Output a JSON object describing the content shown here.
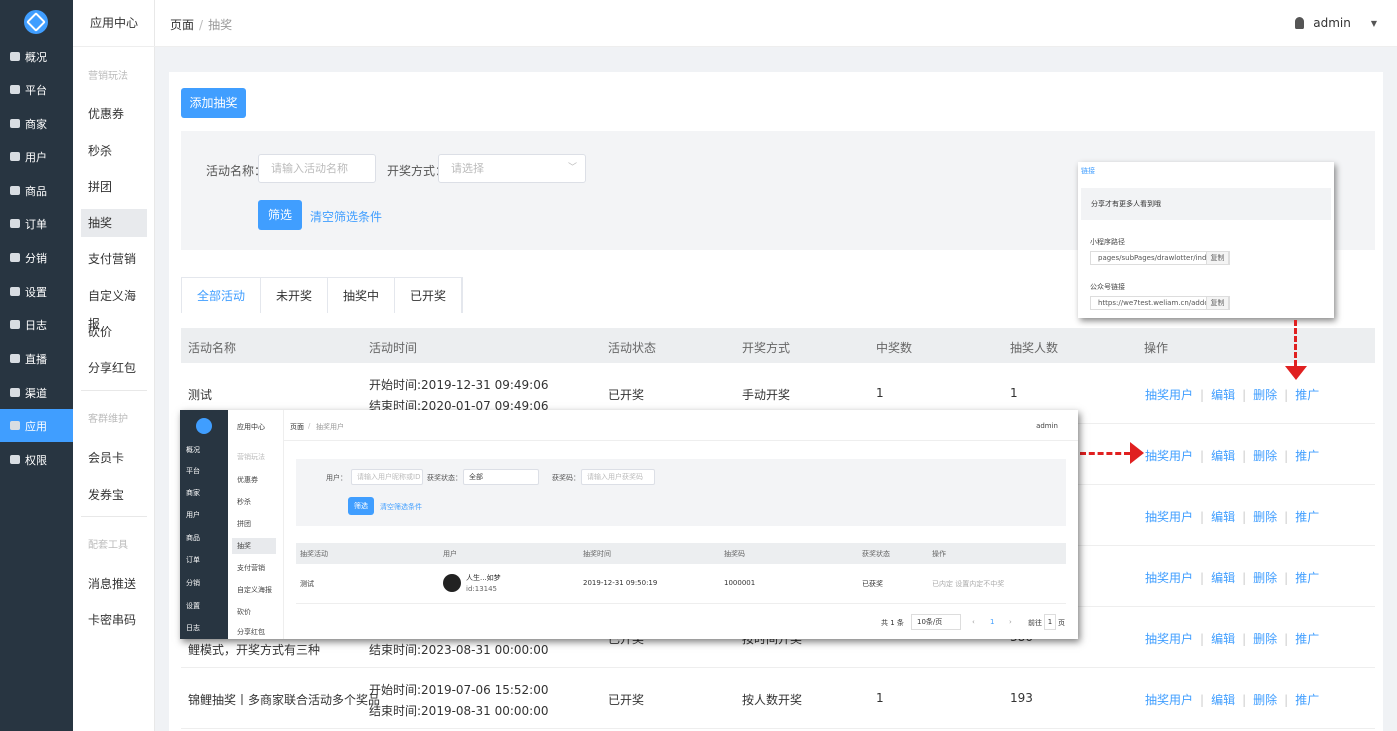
{
  "rail": {
    "items": [
      {
        "label": "概况",
        "icon": "monitor-icon"
      },
      {
        "label": "平台",
        "icon": "platform-icon"
      },
      {
        "label": "商家",
        "icon": "store-icon"
      },
      {
        "label": "用户",
        "icon": "user-icon"
      },
      {
        "label": "商品",
        "icon": "goods-icon"
      },
      {
        "label": "订单",
        "icon": "order-icon"
      },
      {
        "label": "分销",
        "icon": "distribution-icon"
      },
      {
        "label": "设置",
        "icon": "gear-icon"
      },
      {
        "label": "日志",
        "icon": "log-icon"
      },
      {
        "label": "直播",
        "icon": "live-icon"
      },
      {
        "label": "渠道",
        "icon": "channel-icon"
      },
      {
        "label": "应用",
        "icon": "apps-icon"
      },
      {
        "label": "权限",
        "icon": "lock-icon"
      }
    ]
  },
  "side": {
    "title": "应用中心",
    "group1": "营销玩法",
    "g1items": [
      "优惠券",
      "秒杀",
      "拼团",
      "抽奖",
      "支付营销",
      "自定义海报",
      "砍价",
      "分享红包"
    ],
    "group2": "客群维护",
    "g2items": [
      "会员卡",
      "发券宝"
    ],
    "group3": "配套工具",
    "g3items": [
      "消息推送",
      "卡密串码"
    ]
  },
  "topbar": {
    "crumb1": "页面",
    "sep": "/",
    "crumb2": "抽奖",
    "user": "admin",
    "caret": "▼"
  },
  "main": {
    "add_button": "添加抽奖",
    "filter": {
      "name_label": "活动名称：",
      "name_placeholder": "请输入活动名称",
      "mode_label": "开奖方式：",
      "mode_placeholder": "请选择",
      "search": "筛选",
      "clear": "清空筛选条件"
    },
    "tabs": [
      "全部活动",
      "未开奖",
      "抽奖中",
      "已开奖"
    ],
    "columns": [
      "活动名称",
      "活动时间",
      "活动状态",
      "开奖方式",
      "中奖数",
      "抽奖人数",
      "操作"
    ],
    "rows": [
      {
        "name": "测试",
        "start": "开始时间:2019-12-31 09:49:06",
        "end": "结束时间:2020-01-07 09:49:06",
        "status": "已开奖",
        "mode": "手动开奖",
        "winners": "1",
        "players": "1"
      },
      {
        "name": "",
        "start": "",
        "end": "",
        "status": "",
        "mode": "",
        "winners": "",
        "players": ""
      },
      {
        "name": "",
        "start": "",
        "end": "",
        "status": "",
        "mode": "",
        "winners": "",
        "players": ""
      },
      {
        "name": "",
        "start": "",
        "end": "",
        "status": "",
        "mode": "",
        "winners": "",
        "players": ""
      },
      {
        "name": "鲤模式，开奖方式有三种",
        "start": "",
        "end": "结束时间:2023-08-31 00:00:00",
        "status": "已开奖",
        "mode": "按时间开奖",
        "winners": "",
        "players": "386"
      },
      {
        "name": "锦鲤抽奖丨多商家联合活动多个奖品",
        "start": "开始时间:2019-07-06 15:52:00",
        "end": "结束时间:2019-08-31 00:00:00",
        "status": "已开奖",
        "mode": "按人数开奖",
        "winners": "1",
        "players": "193"
      }
    ],
    "ops": {
      "users": "抽奖用户",
      "edit": "编辑",
      "delete": "删除",
      "promote": "推广",
      "sep": "|"
    }
  },
  "popup": {
    "link": "链接",
    "band": "分享才有更多人看到哦",
    "mini_label": "小程序路径",
    "mini_value": "pages/subPages/drawlotter/index",
    "official_label": "公众号链接",
    "official_value": "https://we7test.weliam.cn/addons",
    "copy": "复制"
  },
  "inset": {
    "side_title": "应用中心",
    "group": "营销玩法",
    "side_items": [
      "优惠券",
      "秒杀",
      "拼团",
      "抽奖",
      "支付营销",
      "自定义海报",
      "砍价",
      "分享红包"
    ],
    "rail": [
      "概况",
      "平台",
      "商家",
      "用户",
      "商品",
      "订单",
      "分销",
      "设置",
      "日志"
    ],
    "crumb1": "页面",
    "crumb2": "抽奖用户",
    "user": "admin",
    "f_user": "用户：",
    "f_user_ph": "请输入用户昵称或ID",
    "f_state": "获奖状态：",
    "f_state_val": "全部",
    "f_code": "获奖码：",
    "f_code_ph": "请输入用户获奖码",
    "search": "筛选",
    "clear": "清空筛选条件",
    "columns": [
      "抽奖活动",
      "用户",
      "抽奖时间",
      "抽奖码",
      "获奖状态",
      "操作"
    ],
    "row": {
      "activity": "测试",
      "user": "人生...如梦",
      "uid": "id:13145",
      "time": "2019-12-31 09:50:19",
      "code": "1000001",
      "state": "已获奖",
      "op": "已内定 设置内定不中奖"
    },
    "total": "共 1 条",
    "page_size": "10条/页",
    "page": "1",
    "goto": "前往",
    "goto_page": "1",
    "goto_unit": "页"
  }
}
